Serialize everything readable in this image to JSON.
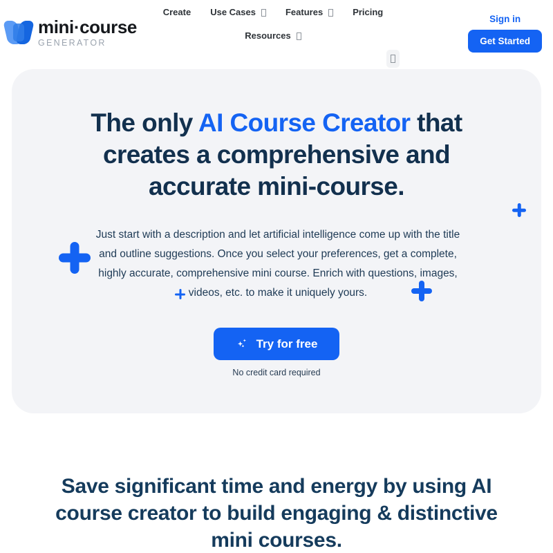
{
  "header": {
    "brand": {
      "title": "mini·course",
      "subtitle": "GENERATOR",
      "logo_icon": "minicourse-butterfly-logo"
    },
    "nav": [
      {
        "label": "Create",
        "has_dropdown": false
      },
      {
        "label": "Use Cases",
        "has_dropdown": true
      },
      {
        "label": "Features",
        "has_dropdown": true
      },
      {
        "label": "Pricing",
        "has_dropdown": false
      },
      {
        "label": "Resources",
        "has_dropdown": true
      }
    ],
    "sign_in_label": "Sign in",
    "get_started_label": "Get Started",
    "lang_chip_glyph": " "
  },
  "hero": {
    "title_part1": "The only ",
    "title_accent": "AI Course Creator",
    "title_part2": " that creates a comprehensive and accurate mini-course.",
    "subtitle": "Just start with a description and let artificial intelligence come up with the title and outline suggestions. Once you select your preferences, get a complete, highly accurate, comprehensive mini course. Enrich with questions, images, videos, etc. to make it uniquely yours.",
    "cta_label": "Try for free",
    "cta_icon": "sparkles-icon",
    "cta_note": "No credit card required"
  },
  "section": {
    "heading": "Save significant time and energy by using AI course creator to build engaging & distinctive mini courses."
  },
  "colors": {
    "brand_blue": "#1463f3",
    "heading_navy": "#12304e",
    "card_background": "#f3f4f7",
    "page_background": "#ffffff",
    "nav_text": "#2e3338",
    "brand_sub_gray": "#9aa3ae"
  }
}
